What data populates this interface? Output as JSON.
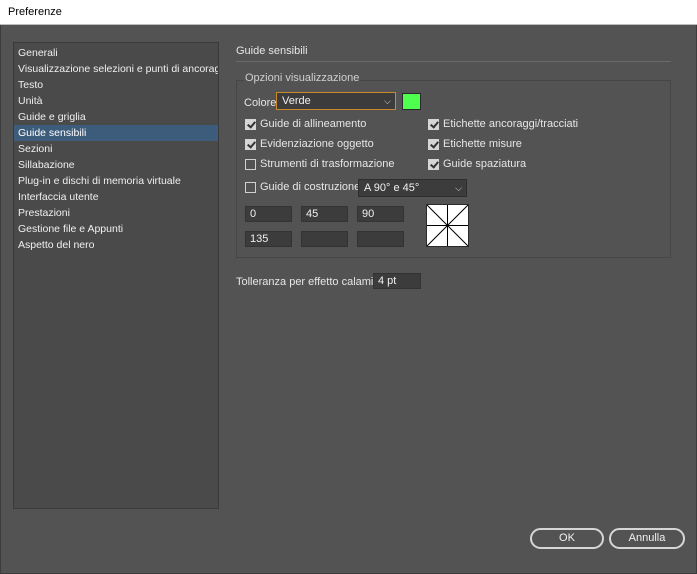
{
  "window": {
    "title": "Preferenze"
  },
  "sidebar": {
    "items": [
      {
        "label": "Generali"
      },
      {
        "label": "Visualizzazione selezioni e punti di ancoraggio"
      },
      {
        "label": "Testo"
      },
      {
        "label": "Unità"
      },
      {
        "label": "Guide e griglia"
      },
      {
        "label": "Guide sensibili"
      },
      {
        "label": "Sezioni"
      },
      {
        "label": "Sillabazione"
      },
      {
        "label": "Plug-in e dischi di memoria virtuale"
      },
      {
        "label": "Interfaccia utente"
      },
      {
        "label": "Prestazioni"
      },
      {
        "label": "Gestione file e Appunti"
      },
      {
        "label": "Aspetto del nero"
      }
    ],
    "selected_label": "Guide sensibili"
  },
  "panel": {
    "title": "Guide sensibili",
    "display_options": {
      "legend": "Opzioni visualizzazione",
      "color_label": "Colore:",
      "color_value": "Verde",
      "swatch_color": "#4fff4f",
      "checkboxes_left": [
        {
          "label": "Guide di allineamento",
          "checked": true
        },
        {
          "label": "Evidenziazione oggetto",
          "checked": true
        },
        {
          "label": "Strumenti di trasformazione",
          "checked": false
        }
      ],
      "checkboxes_right": [
        {
          "label": "Etichette ancoraggi/tracciati",
          "checked": true
        },
        {
          "label": "Etichette misure",
          "checked": true
        },
        {
          "label": "Guide spaziatura",
          "checked": true
        }
      ],
      "construction_guides": {
        "label": "Guide di costruzione:",
        "checked": false,
        "value": "A 90° e 45°"
      },
      "angles": [
        "0",
        "45",
        "90",
        "135",
        "",
        ""
      ]
    },
    "snapping": {
      "label": "Tolleranza per effetto calamita:",
      "value": "4 pt"
    }
  },
  "buttons": {
    "ok": "OK",
    "cancel": "Annulla"
  },
  "colors": {
    "selection": "#3d5b7a",
    "focus_border": "#c98a2a",
    "background": "#535353"
  }
}
